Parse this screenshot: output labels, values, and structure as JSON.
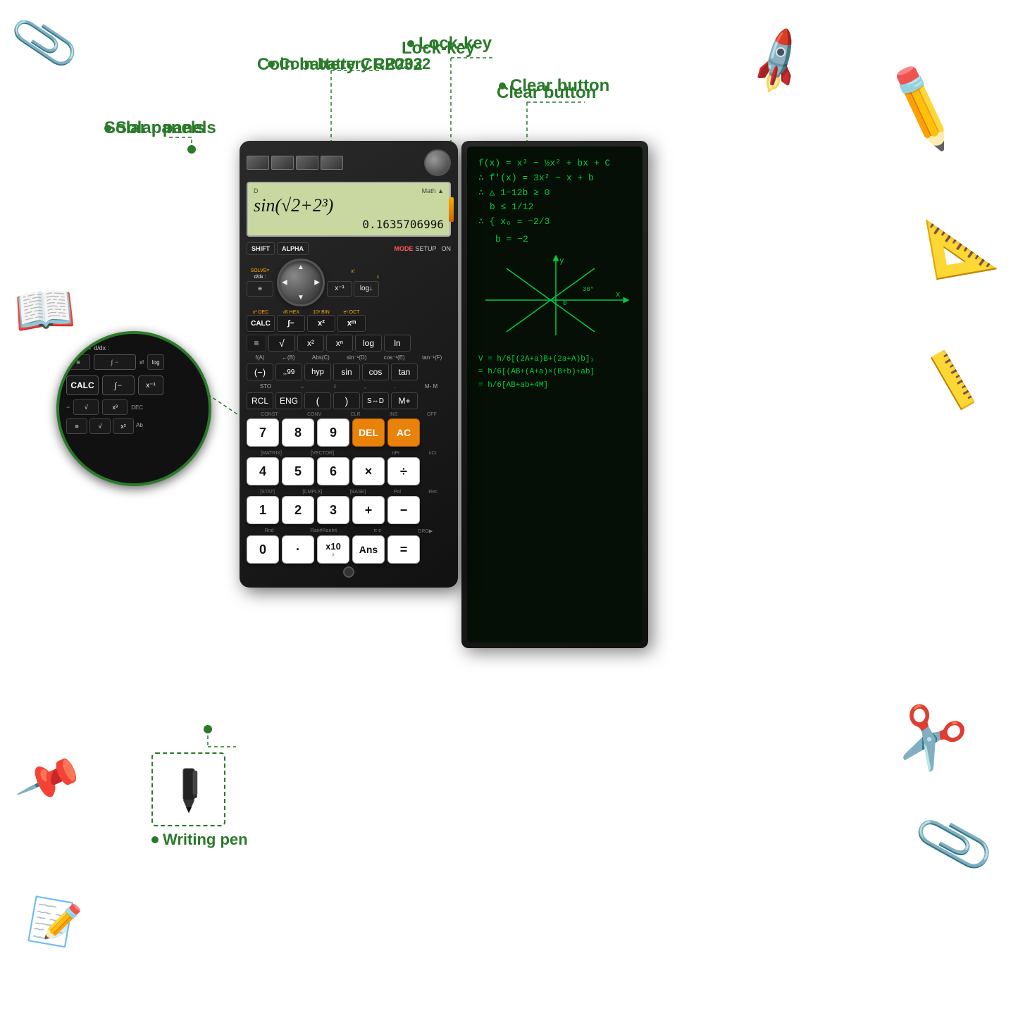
{
  "labels": {
    "solar_panels": "Solar panels",
    "coin_battery": "Coin battery CR2032",
    "lock_key": "Lock-key",
    "clear_button": "Clear button",
    "writing_pen": "Writing pen"
  },
  "calculator": {
    "display": {
      "mode": "Math",
      "indicator": "D",
      "main_expression": "sin(√2+2³)",
      "result": "0.1635706996"
    },
    "buttons": {
      "row1": [
        "SHIFT",
        "ALPHA",
        "MODE",
        "SETUP",
        "ON"
      ],
      "row_solve": [
        "SOLVE=",
        "d/dx :",
        "x!",
        "log↓"
      ],
      "row2": [
        "CALC",
        "∫-",
        "x⁻¹",
        "log↓"
      ],
      "row3": [
        "≡",
        "√",
        "x²",
        "x^m",
        "log",
        "ln"
      ],
      "row4": [
        "f(A)",
        "←(B)",
        "Abs(C)",
        "sin⁻¹(D)",
        "cos⁻¹(E)",
        "tan⁻¹(F)"
      ],
      "row5": [
        "(-)",
        ",,99",
        "hyp",
        "sin",
        "cos",
        "tan"
      ],
      "row6": [
        "STO",
        "←",
        "i",
        ",",
        ".",
        "M- M"
      ],
      "row7": [
        "RCL",
        "ENG",
        "(",
        ")",
        "S⇔D",
        "M+"
      ],
      "row8_labels": [
        "CONST",
        "CONV",
        "CLR",
        "INS",
        "OFF"
      ],
      "row8": [
        "7",
        "8",
        "9",
        "DEL",
        "AC"
      ],
      "row9_labels": [
        "[MATRIX]",
        "[VECTOR]",
        "",
        "nPr",
        "nCr"
      ],
      "row9": [
        "4",
        "5",
        "6",
        "×",
        "÷"
      ],
      "row10_labels": [
        "[STAT]",
        "[CMPLX]",
        "[BASE]",
        "Pol",
        "Rec"
      ],
      "row10": [
        "1",
        "2",
        "3",
        "+",
        "−"
      ],
      "row11_labels": [
        "Rnd",
        "Ran#RanInt",
        "π",
        "e",
        "DRG▶"
      ],
      "row11": [
        "0",
        ".",
        "x10ˣ",
        "Ans",
        "="
      ]
    }
  },
  "notebook": {
    "equations": [
      "f(x) = x³ - ½x² + bx + C",
      "∴ f'(x) = 3x² - x + b",
      "∴ △ 1-12b ≥ 0",
      "    b ≤ 1/12",
      "∴ { x₀ = -2/3",
      "",
      "    b = -2"
    ],
    "graph_note": "y-axis graph with 30° angle",
    "formulas": [
      "V = h/6[(2A+a)B+(2a+A)b]₂",
      "= h/6[(AB+(A+a)×(B+b)+ab]",
      "= h/6[AB+ab+4M]"
    ]
  },
  "magnified": {
    "labels": [
      "SOLVE=",
      "d/dx :",
      "CALC",
      "∫-",
      "x³ DEC"
    ],
    "calc_label": "CALC"
  },
  "colors": {
    "annotation_green": "#2a7a2a",
    "del_button": "#e8820a",
    "ac_button": "#e8820a",
    "display_bg": "#c8d8a0",
    "calc_body": "#1a1a1a"
  }
}
